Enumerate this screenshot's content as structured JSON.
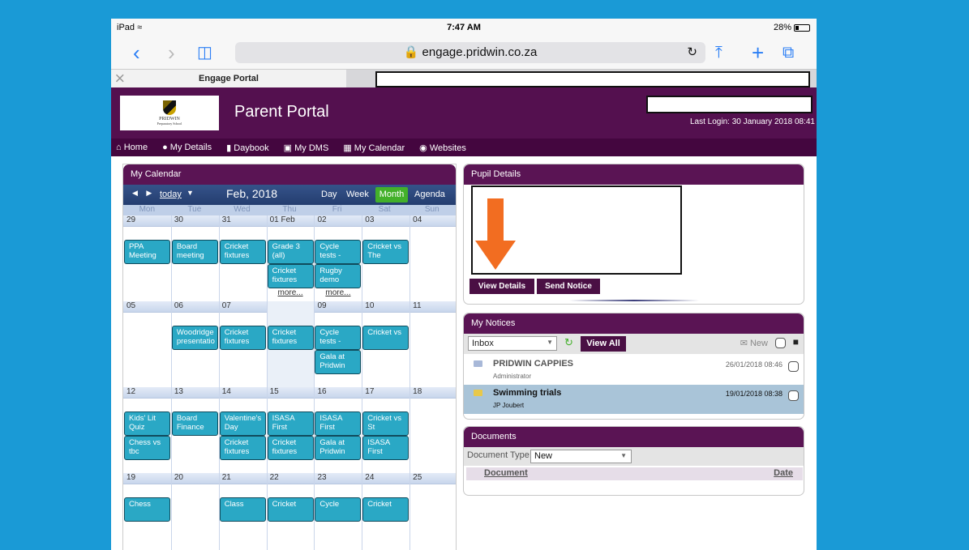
{
  "status_bar": {
    "device": "iPad",
    "time": "7:47 AM",
    "battery": "28%"
  },
  "browser": {
    "url": "engage.pridwin.co.za",
    "tab_title": "Engage Portal"
  },
  "header": {
    "logo_text": "PRIDWIN",
    "logo_subtext": "Preparatory School",
    "title": "Parent Portal",
    "last_login": "Last Login: 30 January 2018 08:41"
  },
  "menu": [
    "Home",
    "My Details",
    "Daybook",
    "My DMS",
    "My Calendar",
    "Websites"
  ],
  "calendar": {
    "title": "My Calendar",
    "today_label": "today",
    "month_title": "Feb, 2018",
    "views": [
      "Day",
      "Week",
      "Month",
      "Agenda"
    ],
    "active_view": "Month",
    "weekdays": [
      "Mon",
      "Tue",
      "Wed",
      "Thu",
      "Fri",
      "Sat",
      "Sun"
    ],
    "weeks": [
      {
        "days": [
          "29",
          "30",
          "31",
          "01 Feb",
          "02",
          "03",
          "04"
        ],
        "events": [
          {
            "col": 0,
            "row": 0,
            "text": "PPA Meeting"
          },
          {
            "col": 1,
            "row": 0,
            "text": "Board meeting"
          },
          {
            "col": 2,
            "row": 0,
            "text": "Cricket fixtures"
          },
          {
            "col": 3,
            "row": 0,
            "text": "Grade 3 (all)"
          },
          {
            "col": 4,
            "row": 0,
            "text": "Cycle tests -"
          },
          {
            "col": 5,
            "row": 0,
            "text": "Cricket vs The"
          },
          {
            "col": 3,
            "row": 1,
            "text": "Cricket fixtures"
          },
          {
            "col": 4,
            "row": 1,
            "text": "Rugby demo"
          }
        ],
        "more": [
          {
            "col": 3,
            "text": "more..."
          },
          {
            "col": 4,
            "text": "more..."
          }
        ]
      },
      {
        "days": [
          "05",
          "06",
          "07",
          "08",
          "09",
          "10",
          "11"
        ],
        "events": [
          {
            "col": 1,
            "row": 0,
            "text": "Woodridge presentatio"
          },
          {
            "col": 2,
            "row": 0,
            "text": "Cricket fixtures"
          },
          {
            "col": 3,
            "row": 0,
            "text": "Cricket fixtures"
          },
          {
            "col": 4,
            "row": 0,
            "text": "Cycle tests -"
          },
          {
            "col": 5,
            "row": 0,
            "text": "Cricket vs"
          },
          {
            "col": 4,
            "row": 1,
            "text": "Gala at Pridwin"
          }
        ],
        "more": []
      },
      {
        "days": [
          "12",
          "13",
          "14",
          "15",
          "16",
          "17",
          "18"
        ],
        "events": [
          {
            "col": 0,
            "row": 0,
            "text": "Kids' Lit Quiz"
          },
          {
            "col": 1,
            "row": 0,
            "text": "Board Finance"
          },
          {
            "col": 2,
            "row": 0,
            "text": "Valentine's Day"
          },
          {
            "col": 3,
            "row": 0,
            "text": "ISASA First"
          },
          {
            "col": 4,
            "row": 0,
            "text": "ISASA First"
          },
          {
            "col": 5,
            "row": 0,
            "text": "Cricket vs St"
          },
          {
            "col": 0,
            "row": 1,
            "text": "Chess vs tbc"
          },
          {
            "col": 2,
            "row": 1,
            "text": "Cricket fixtures"
          },
          {
            "col": 3,
            "row": 1,
            "text": "Cricket fixtures"
          },
          {
            "col": 4,
            "row": 1,
            "text": "Gala at Pridwin"
          },
          {
            "col": 5,
            "row": 1,
            "text": "ISASA First"
          }
        ],
        "more": []
      },
      {
        "days": [
          "19",
          "20",
          "21",
          "22",
          "23",
          "24",
          "25"
        ],
        "events": [
          {
            "col": 0,
            "row": 0,
            "text": "Chess"
          },
          {
            "col": 2,
            "row": 0,
            "text": "Class"
          },
          {
            "col": 3,
            "row": 0,
            "text": "Cricket"
          },
          {
            "col": 4,
            "row": 0,
            "text": "Cycle"
          },
          {
            "col": 5,
            "row": 0,
            "text": "Cricket"
          }
        ],
        "more": []
      }
    ]
  },
  "pupil": {
    "title": "Pupil Details",
    "view_details": "View Details",
    "send_notice": "Send Notice"
  },
  "notices": {
    "title": "My Notices",
    "folder": "Inbox",
    "view_all": "View All",
    "new_label": "New",
    "items": [
      {
        "subject": "PRIDWIN CAPPIES",
        "sender": "Administrator",
        "date": "26/01/2018 08:46",
        "read": true
      },
      {
        "subject": "Swimming trials",
        "sender": "JP Joubert",
        "date": "19/01/2018 08:38",
        "read": false
      }
    ]
  },
  "documents": {
    "title": "Documents",
    "type_label": "Document Type:",
    "type_value": "New",
    "col_document": "Document",
    "col_date": "Date"
  },
  "colors": {
    "brand": "#54104f",
    "accent": "#2aa8c5",
    "month_active": "#43b02a",
    "background": "#1a9ad6",
    "arrow": "#f26d21"
  }
}
